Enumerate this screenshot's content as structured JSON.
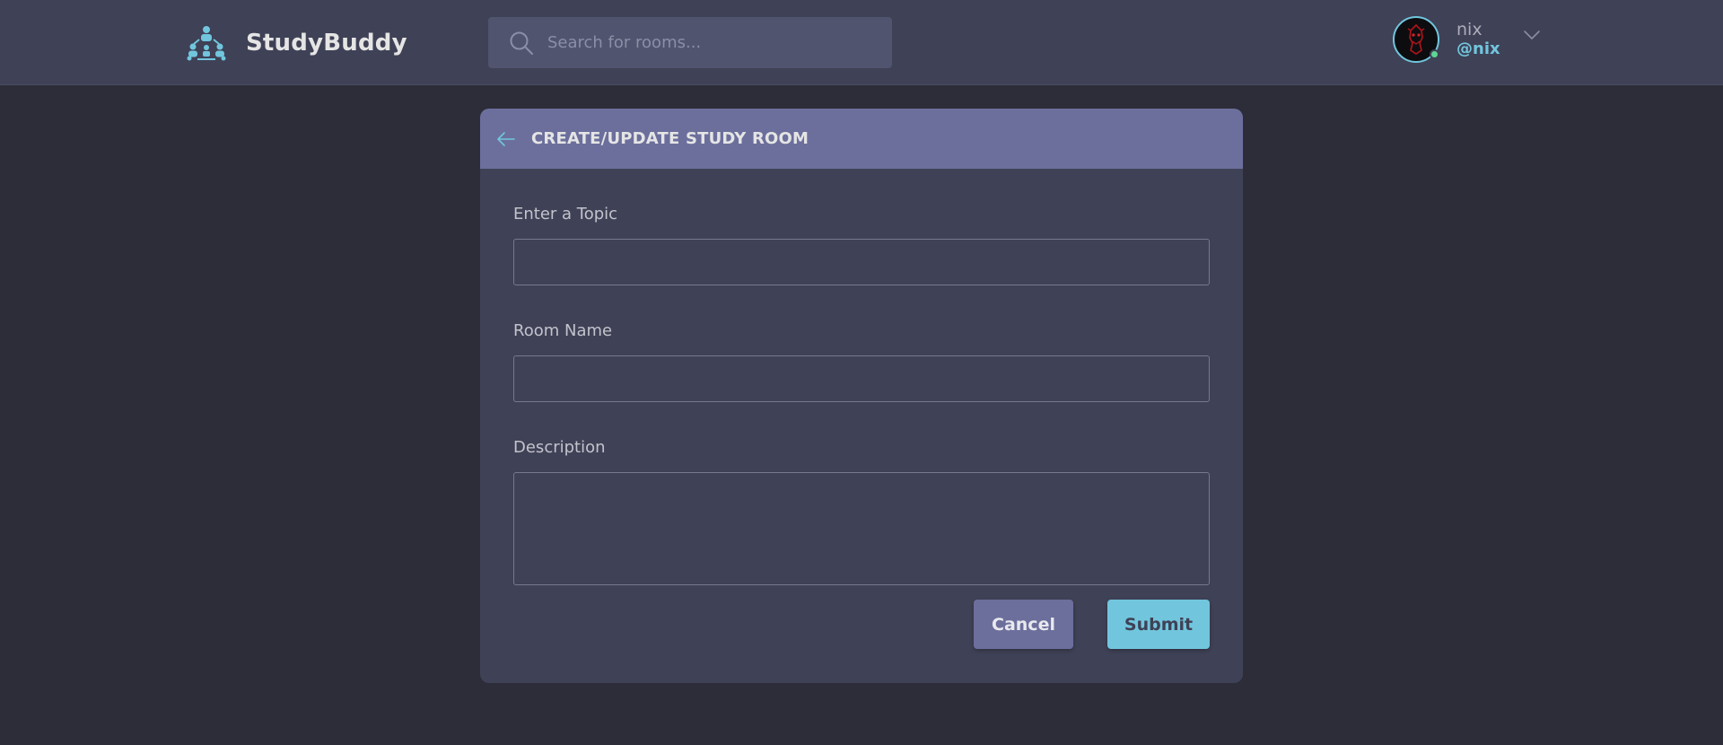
{
  "app": {
    "name": "StudyBuddy"
  },
  "search": {
    "placeholder": "Search for rooms..."
  },
  "user": {
    "name": "nix",
    "handle": "@nix",
    "status_color": "#5dd693"
  },
  "card": {
    "title": "CREATE/UPDATE STUDY ROOM",
    "fields": [
      {
        "label": "Enter a Topic",
        "value": ""
      },
      {
        "label": "Room Name",
        "value": ""
      },
      {
        "label": "Description",
        "value": ""
      }
    ],
    "cancel_label": "Cancel",
    "submit_label": "Submit"
  },
  "icons": {
    "logo": "users-network-icon",
    "search": "search-icon",
    "chevron": "chevron-down-icon",
    "back": "arrow-left-icon"
  },
  "colors": {
    "background": "#2d2d39",
    "header": "#3f4156",
    "card_header": "#6c6f9c",
    "accent": "#71c6dd"
  }
}
